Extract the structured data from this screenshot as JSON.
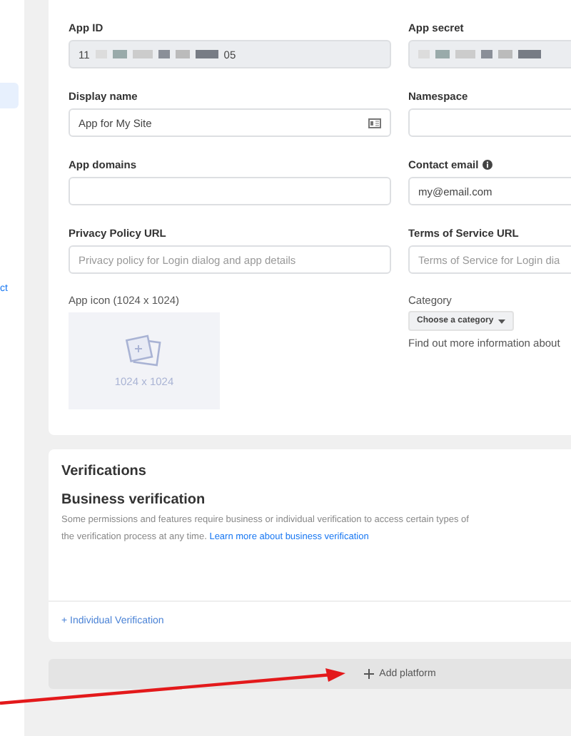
{
  "sidebar": {
    "items": [
      {
        "selected": true
      },
      {
        "label": "ct",
        "selected": false
      }
    ]
  },
  "basic_settings": {
    "fields": [
      {
        "label": "App ID",
        "kind": "redacted",
        "value_start": "11",
        "value_end": "05"
      },
      {
        "label": "App secret",
        "kind": "redacted"
      },
      {
        "label": "Display name",
        "kind": "input",
        "value": "App for My Site",
        "card_icon": true
      },
      {
        "label": "Namespace",
        "kind": "input"
      },
      {
        "label": "App domains",
        "kind": "input"
      },
      {
        "label": "Contact email",
        "kind": "input",
        "value": "my@email.com",
        "info_icon": true
      },
      {
        "label": "Privacy Policy URL",
        "kind": "input",
        "placeholder": "Privacy policy for Login dialog and app details"
      },
      {
        "label": "Terms of Service URL",
        "kind": "input",
        "placeholder": "Terms of Service for Login dia"
      }
    ],
    "app_icon": {
      "label": "App icon (1024 x 1024)",
      "size_text": "1024 x 1024"
    },
    "category": {
      "label": "Category",
      "button": "Choose a category",
      "info": "Find out more information about"
    }
  },
  "verifications": {
    "title": "Verifications",
    "subtitle": "Business verification",
    "lines": [
      "Some permissions and features require business or individual verification to access certain types of",
      "the verification process at any time."
    ],
    "link": "Learn more about business verification",
    "action": "+ Individual Verification"
  },
  "add_platform": {
    "label": "Add platform"
  }
}
